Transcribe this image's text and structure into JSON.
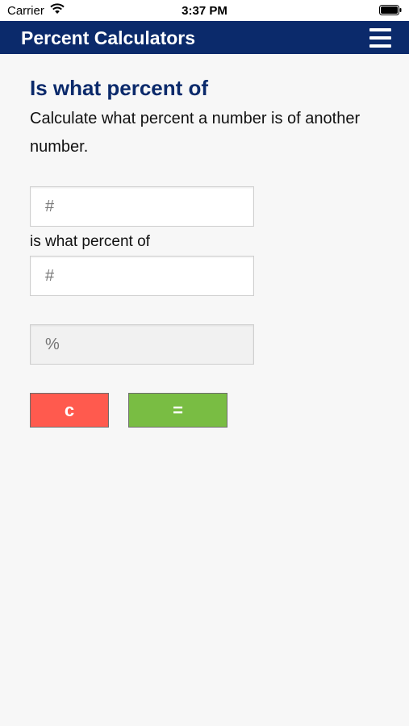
{
  "status": {
    "carrier": "Carrier",
    "time": "3:37 PM"
  },
  "navbar": {
    "title": "Percent Calculators",
    "menu_icon": "hamburger-menu-icon"
  },
  "calculator": {
    "heading": "Is what percent of",
    "description": "Calculate what percent a number is of another number.",
    "first_input_placeholder": "#",
    "between_label": "is what percent of",
    "second_input_placeholder": "#",
    "result_placeholder": "%",
    "clear_label": "c",
    "equals_label": "="
  },
  "colors": {
    "nav_background": "#0b2a6b",
    "heading": "#0b2a6b",
    "clear_button": "#ff5a4e",
    "equals_button": "#79bd43"
  }
}
